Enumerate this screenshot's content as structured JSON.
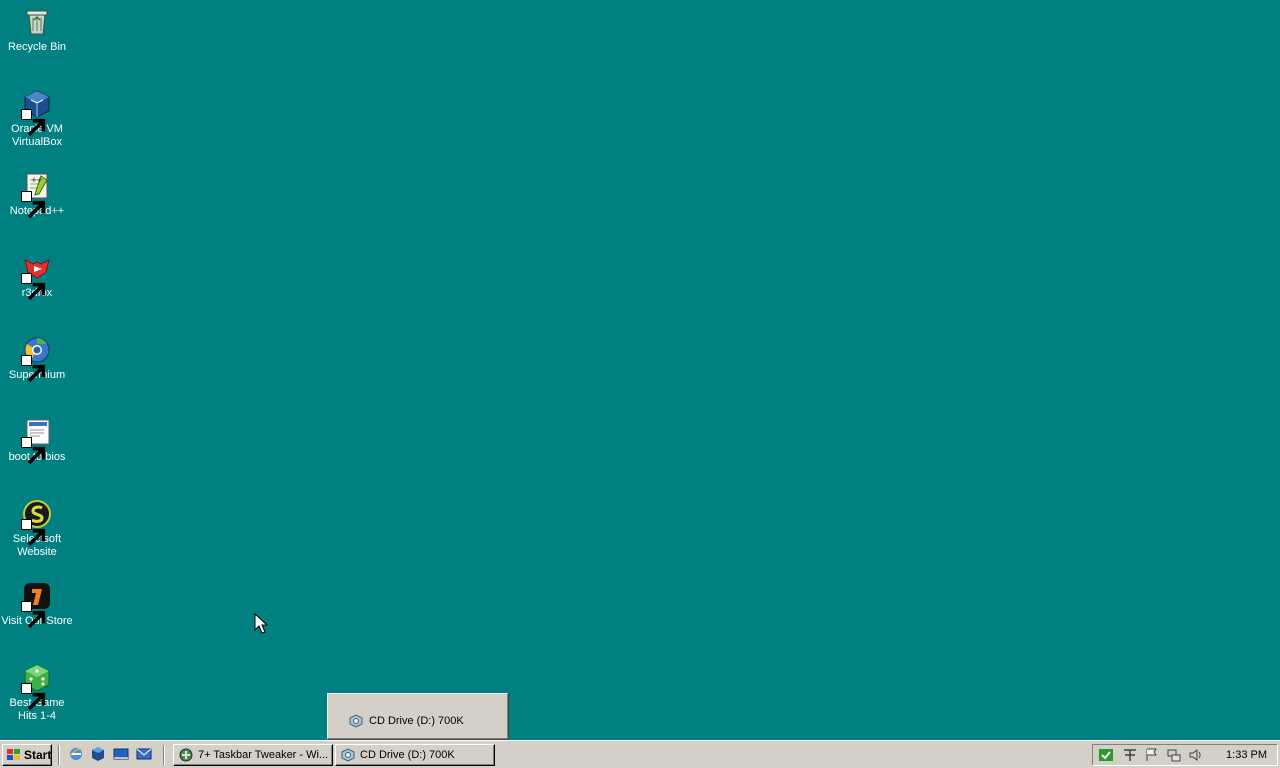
{
  "desktop": {
    "background_color": "#008080",
    "icons": [
      {
        "label": "Recycle Bin",
        "icon": "recycle-bin-icon"
      },
      {
        "label": "Oracle VM VirtualBox",
        "icon": "virtualbox-icon"
      },
      {
        "label": "Notepad++",
        "icon": "notepad-plus-plus-icon"
      },
      {
        "label": "r3dfox",
        "icon": "r3dfox-icon"
      },
      {
        "label": "Supermium",
        "icon": "supermium-icon"
      },
      {
        "label": "boot to bios",
        "icon": "boot-to-bios-icon"
      },
      {
        "label": "Selectsoft Website",
        "icon": "selectsoft-icon"
      },
      {
        "label": "Visit Our Store",
        "icon": "store-icon"
      },
      {
        "label": "Best Game Hits 1-4",
        "icon": "game-icon"
      }
    ]
  },
  "preview": {
    "label": "CD Drive (D:) 700K",
    "icon": "cd-drive-icon"
  },
  "taskbar": {
    "start_label": "Start",
    "quick_launch": [
      "internet-explorer-icon",
      "virtualbox-icon",
      "show-desktop-icon",
      "outlook-express-icon"
    ],
    "tasks": [
      {
        "label": "7+ Taskbar Tweaker - Wi...",
        "icon": "tweaker-icon"
      },
      {
        "label": "CD Drive (D:) 700K",
        "icon": "cd-drive-icon"
      }
    ],
    "tray_icons": [
      "check-icon",
      "input-method-icon",
      "flag-icon",
      "network-icon",
      "volume-icon"
    ],
    "clock": "1:33 PM"
  }
}
